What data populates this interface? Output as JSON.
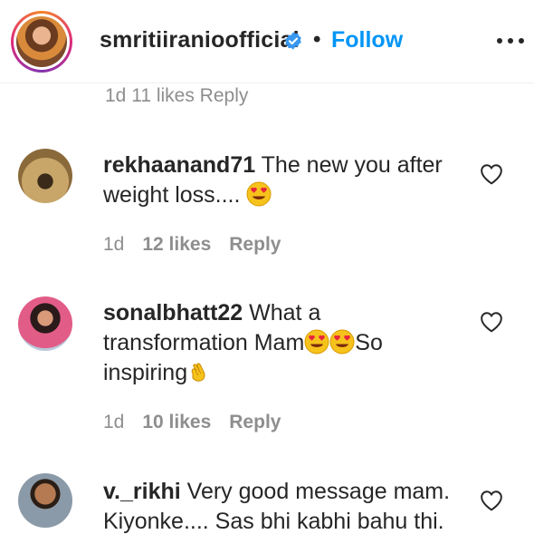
{
  "header": {
    "username": "smritiiranioofficial",
    "separator": "•",
    "follow_label": "Follow"
  },
  "cut_row_text": "1d   11 likes   Reply",
  "comments": [
    {
      "author": "rekhaanand71",
      "text": "The new you after weight loss....",
      "emojis": [
        "heart-eyes"
      ],
      "time": "1d",
      "likes": "12 likes",
      "reply": "Reply"
    },
    {
      "author": "sonalbhatt22",
      "text_a": "What a transformation Mam",
      "text_b": "So inspiring",
      "emojis": [
        "heart-eyes",
        "heart-eyes",
        "clapping-hands"
      ],
      "time": "1d",
      "likes": "10 likes",
      "reply": "Reply"
    },
    {
      "author": "v._rikhi",
      "text": "Very good message mam. Kiyonke.... Sas bhi kabhi bahu thi."
    }
  ],
  "colors": {
    "follow": "#0095f6",
    "verified": "#3897f0",
    "meta": "#8e8e8e",
    "text": "#262626"
  },
  "icons": {
    "verified": "verified-badge-icon",
    "more": "more-options-icon",
    "like": "heart-outline-icon"
  }
}
